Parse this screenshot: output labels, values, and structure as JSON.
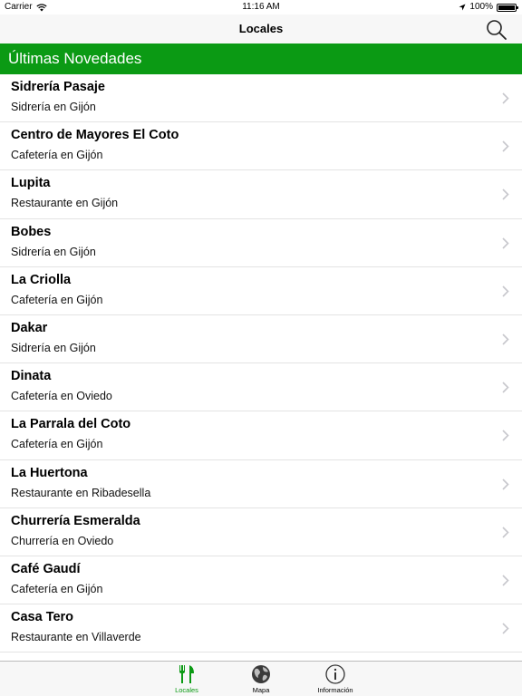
{
  "status_bar": {
    "carrier": "Carrier",
    "time": "11:16 AM",
    "battery_percent": "100%",
    "battery_level": 1.0
  },
  "nav_bar": {
    "title": "Locales",
    "search_icon": "search-icon"
  },
  "section": {
    "title": "Últimas Novedades",
    "color": "#0b9a14"
  },
  "places": [
    {
      "name": "Sidrería Pasaje",
      "subtitle": "Sidrería en Gijón"
    },
    {
      "name": "Centro de Mayores El Coto",
      "subtitle": "Cafetería en Gijón"
    },
    {
      "name": "Lupita",
      "subtitle": "Restaurante en Gijón"
    },
    {
      "name": "Bobes",
      "subtitle": "Sidrería en Gijón"
    },
    {
      "name": "La Criolla",
      "subtitle": "Cafetería en Gijón"
    },
    {
      "name": "Dakar",
      "subtitle": "Sidrería en Gijón"
    },
    {
      "name": "Dinata",
      "subtitle": "Cafetería en Oviedo"
    },
    {
      "name": "La Parrala del Coto",
      "subtitle": "Cafetería en Gijón"
    },
    {
      "name": "La Huertona",
      "subtitle": "Restaurante en Ribadesella"
    },
    {
      "name": "Churrería Esmeralda",
      "subtitle": "Churrería en Oviedo"
    },
    {
      "name": "Café Gaudí",
      "subtitle": "Cafetería en Gijón"
    },
    {
      "name": "Casa Tero",
      "subtitle": "Restaurante en Villaverde"
    }
  ],
  "tab_bar": {
    "tabs": [
      {
        "label": "Locales",
        "icon": "fork-knife-icon",
        "active": true
      },
      {
        "label": "Mapa",
        "icon": "globe-icon",
        "active": false
      },
      {
        "label": "Información",
        "icon": "info-icon",
        "active": false
      }
    ],
    "active_color": "#0b9a14"
  }
}
